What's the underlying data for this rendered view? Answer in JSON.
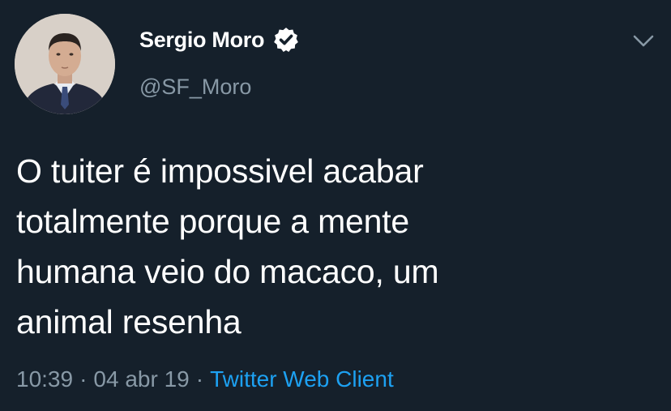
{
  "author": {
    "display_name": "Sergio Moro",
    "handle": "@SF_Moro",
    "verified": true,
    "avatar_icon": "profile-photo"
  },
  "tweet": {
    "lines": [
      "O tuiter é impossivel acabar",
      "totalmente porque a mente",
      "humana veio do macaco, um",
      "animal resenha"
    ]
  },
  "meta": {
    "time": "10:39",
    "separator": "·",
    "date": "04 abr 19",
    "client": "Twitter Web Client"
  },
  "colors": {
    "background": "#15202b",
    "text": "#ffffff",
    "secondary": "#8899a6",
    "accent": "#1da1f2"
  },
  "icons": {
    "verified": "verified-badge-icon",
    "menu": "chevron-down-icon"
  }
}
